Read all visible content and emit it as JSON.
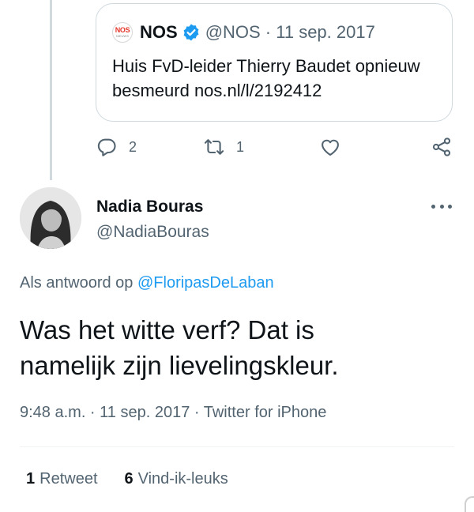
{
  "quoted_tweet": {
    "source_logo_text": "NOS",
    "source_logo_subtext": "NIEUWS",
    "author_name": "NOS",
    "meta": "@NOS · 11 sep. 2017",
    "text_line1": "Huis FvD-leider Thierry Baudet opnieuw",
    "text_line2": "besmeurd nos.nl/l/2192412"
  },
  "action_bar": {
    "reply_count": "2",
    "retweet_count": "1",
    "icons": [
      "reply-icon",
      "retweet-icon",
      "like-icon",
      "share-icon"
    ]
  },
  "tweet": {
    "author_name": "Nadia Bouras",
    "author_handle": "@NadiaBouras",
    "reply_prefix": "Als antwoord op",
    "reply_mention": "@FloripasDeLaban",
    "text_line1": "Was het witte verf? Dat is",
    "text_line2": "namelijk zijn lievelingskleur.",
    "meta": "9:48 a.m. · 11 sep. 2017 · Twitter for iPhone"
  },
  "stats": {
    "retweets_count": "1",
    "retweets_label": "Retweet",
    "likes_count": "6",
    "likes_label": "Vind-ik-leuks"
  },
  "colors": {
    "link": "#1d9bf0",
    "muted": "#536471",
    "border": "#cfd9de",
    "nos_red": "#e5352a"
  }
}
